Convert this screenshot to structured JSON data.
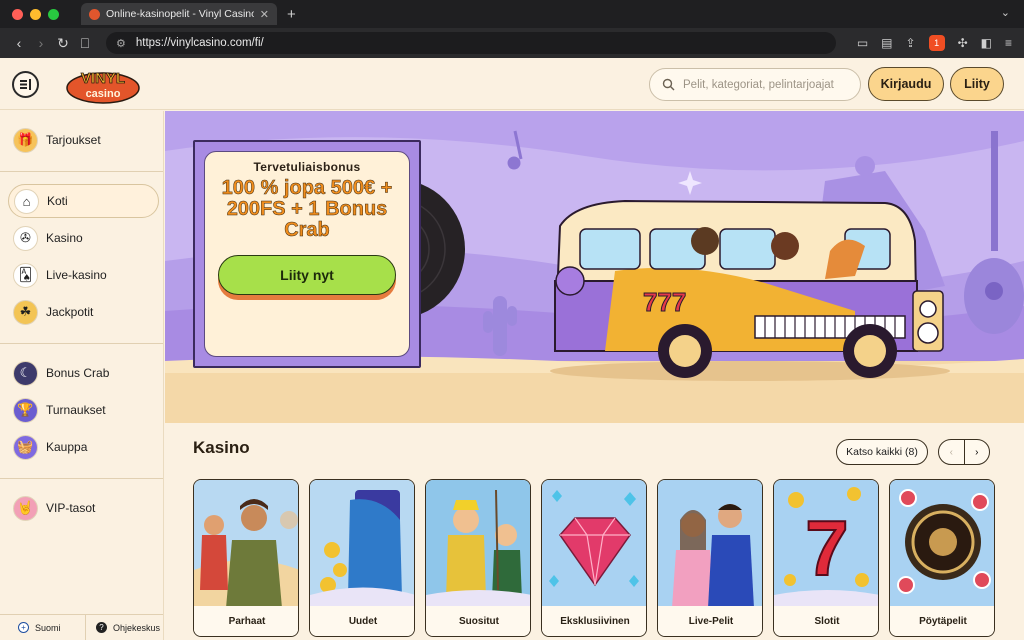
{
  "browser": {
    "tab_title": "Online-kasinopelit - Vinyl Casino",
    "tab_close": "✕",
    "new_tab": "+",
    "url": "https://vinylcasino.com/fi/",
    "brave_badge": "1"
  },
  "header": {
    "logo_top": "VINYL",
    "logo_bottom": "casino",
    "search_placeholder": "Pelit, kategoriat, pelintarjoajat",
    "login_label": "Kirjaudu",
    "join_label": "Liity"
  },
  "sidebar": {
    "items": [
      {
        "label": "Tarjoukset",
        "icon": "gift-icon"
      },
      {
        "label": "Koti",
        "icon": "home-icon"
      },
      {
        "label": "Kasino",
        "icon": "vinyl-icon"
      },
      {
        "label": "Live-kasino",
        "icon": "cards-icon"
      },
      {
        "label": "Jackpotit",
        "icon": "clover-icon"
      },
      {
        "label": "Bonus Crab",
        "icon": "crab-claw-icon"
      },
      {
        "label": "Turnaukset",
        "icon": "trophy-icon"
      },
      {
        "label": "Kauppa",
        "icon": "basket-icon"
      },
      {
        "label": "VIP-tasot",
        "icon": "rock-hand-icon"
      }
    ],
    "footer_language": "Suomi",
    "footer_help": "Ohjekeskus"
  },
  "hero": {
    "kicker": "Tervetuliaisbonus",
    "title": "100 % jopa 500€ + 200FS + 1 Bonus Crab",
    "cta_label": "Liity nyt",
    "van_number": "777"
  },
  "casino": {
    "title": "Kasino",
    "see_all": "Katso kaikki (8)",
    "prev": "‹",
    "next": "›",
    "cards": [
      {
        "label": "Parhaat"
      },
      {
        "label": "Uudet"
      },
      {
        "label": "Suositut"
      },
      {
        "label": "Eksklusiivinen"
      },
      {
        "label": "Live-Pelit"
      },
      {
        "label": "Slotit"
      },
      {
        "label": "Pöytäpelit"
      }
    ]
  },
  "colors": {
    "accent": "#fbd58d",
    "hero_purple": "#b9a2ec",
    "cta_green": "#a7e04a",
    "bonus_orange": "#f08d1d",
    "page_bg": "#fbf1e1"
  }
}
